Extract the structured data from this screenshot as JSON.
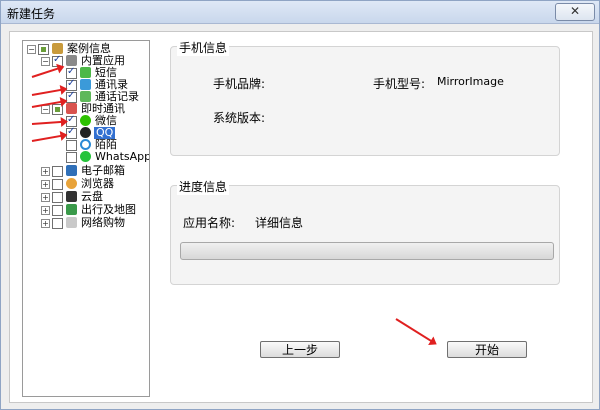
{
  "window": {
    "title": "新建任务",
    "close_label": "✕"
  },
  "tree": {
    "root": "案例信息",
    "builtin": "内置应用",
    "sms": "短信",
    "contacts": "通讯录",
    "calls": "通话记录",
    "im": "即时通讯",
    "wechat": "微信",
    "qq": "QQ",
    "momo": "陌陌",
    "whatsapp": "WhatsApp",
    "email": "电子邮箱",
    "browser": "浏览器",
    "cloud": "云盘",
    "travel": "出行及地图",
    "shopping": "网络购物"
  },
  "phone_info": {
    "title": "手机信息",
    "brand_label": "手机品牌:",
    "model_label": "手机型号:",
    "model_value": "MirrorImage",
    "version_label": "系统版本:"
  },
  "progress_info": {
    "title": "进度信息",
    "app_label": "应用名称:",
    "detail_label": "详细信息",
    "progress": 0
  },
  "buttons": {
    "prev": "上一步",
    "start": "开始"
  },
  "colors": {
    "arrow": "#e02020",
    "selection": "#3270d1",
    "titlebar": "#c9d7ec"
  }
}
